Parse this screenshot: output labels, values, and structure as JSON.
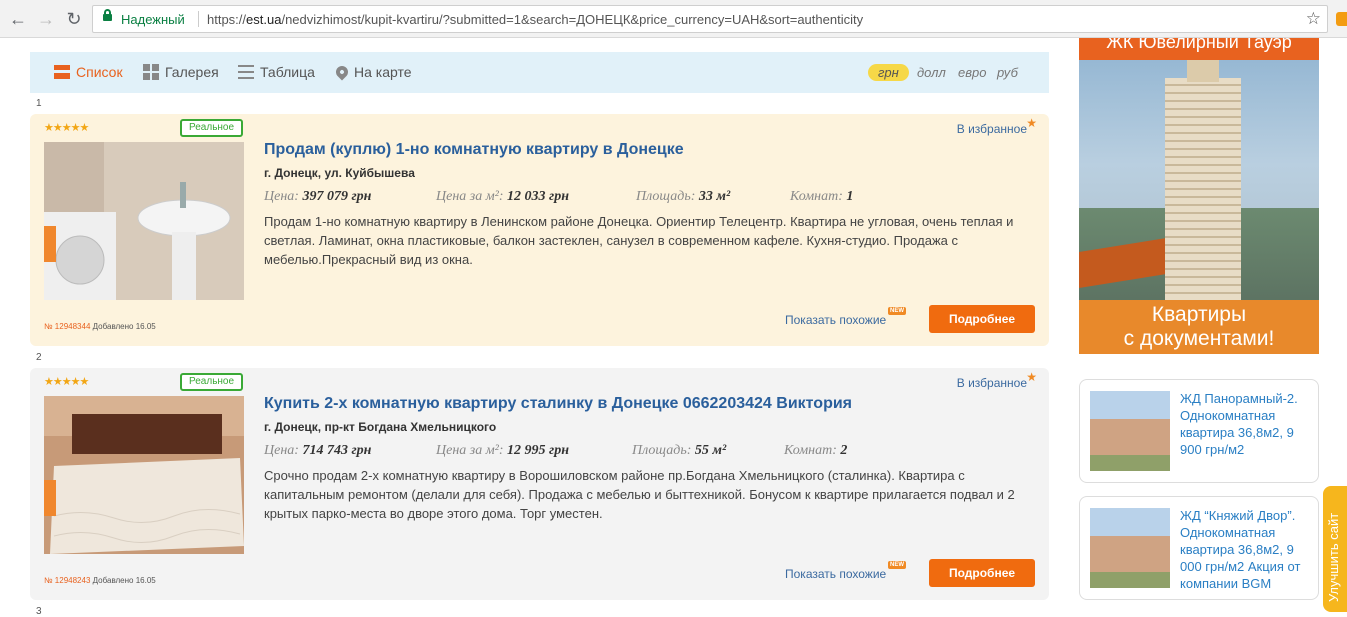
{
  "browser": {
    "secure_label": "Надежный",
    "url_scheme": "https://",
    "url_host": "est.ua",
    "url_path": "/nedvizhimost/kupit-kvartiru/?submitted=1&search=ДОНЕЦК&price_currency=UAH&sort=authenticity"
  },
  "views": [
    "Список",
    "Галерея",
    "Таблица",
    "На карте"
  ],
  "currencies": [
    "грн",
    "долл",
    "евро",
    "руб"
  ],
  "listings": [
    {
      "index": "1",
      "stars": "★★★★★",
      "badge": "Реальное",
      "title": "Продам (куплю) 1-но комнатную квартиру в Донецке",
      "address": "г. Донецк, ул. Куйбышева",
      "price_label": "Цена:",
      "price": "397 079 грн",
      "ppm_label": "Цена за м²:",
      "ppm": "12 033 грн",
      "area_label": "Площадь:",
      "area": "33 м²",
      "rooms_label": "Комнат:",
      "rooms": "1",
      "description": "Продам 1-но комнатную квартиру в Ленинском районе Донецка. Ориентир Телецентр. Квартира не угловая, очень теплая и светлая. Ламинат, окна пластиковые, балкон застеклен, санузел в современном кафеле. Кухня-студио. Продажа с мебелью.Прекрасный вид из окна.",
      "favorite": "В избранное",
      "id": "№ 12948344",
      "added": "Добавлено 16.05",
      "similar": "Показать похожие",
      "new": "NEW",
      "more": "Подробнее"
    },
    {
      "index": "2",
      "stars": "★★★★★",
      "badge": "Реальное",
      "title": "Купить 2-х комнатную квартиру сталинку в Донецке 0662203424 Виктория",
      "address": "г. Донецк, пр-кт Богдана Хмельницкого",
      "price_label": "Цена:",
      "price": "714 743 грн",
      "ppm_label": "Цена за м²:",
      "ppm": "12 995 грн",
      "area_label": "Площадь:",
      "area": "55 м²",
      "rooms_label": "Комнат:",
      "rooms": "2",
      "description": "Срочно продам 2-х комнатную квартиру в Ворошиловском районе пр.Богдана Хмельницкого (сталинка). Квартира с капитальным ремонтом (делали для себя). Продажа с мебелью и быттехникой. Бонусом к квартире прилагается подвал и 2 крытых парко-места во дворе этого дома. Торг уместен.",
      "favorite": "В избранное",
      "id": "№ 12948243",
      "added": "Добавлено 16.05",
      "similar": "Показать похожие",
      "new": "NEW",
      "more": "Подробнее"
    }
  ],
  "next_index": "3",
  "ads": {
    "banner_top": "ЖК Ювелирный Тауэр",
    "banner_bottom_line1": "Квартиры",
    "banner_bottom_line2": "с документами!",
    "promo1": "ЖД Панорамный-2. Однокомнатная квартира 36,8м2, 9 900 грн/м2",
    "promo2": "ЖД “Княжий Двор”. Однокомнатная квартира 36,8м2, 9 000 грн/м2 Акция от компании BGM"
  },
  "side_tab": "Улучшить сайт",
  "colors": {
    "accent": "#e8621f",
    "link": "#2a5f9c",
    "real": "#3aa936"
  }
}
